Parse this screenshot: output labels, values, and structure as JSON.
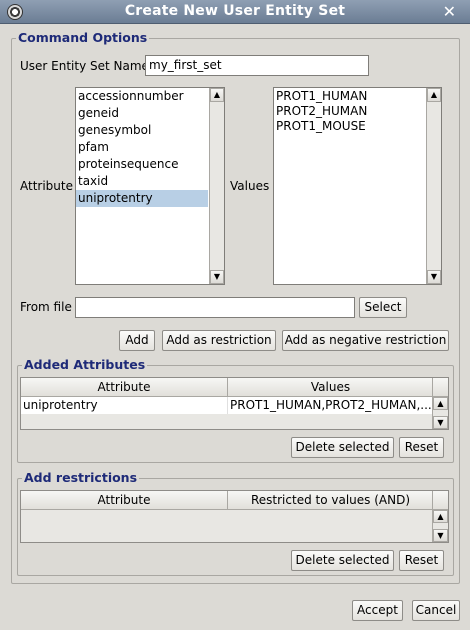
{
  "window": {
    "title": "Create New User Entity Set",
    "close_glyph": "✕",
    "icon": "app-icon"
  },
  "command_options": {
    "legend": "Command Options",
    "set_name_label": "User Entity Set Name",
    "set_name_value": "my_first_set",
    "attribute_label": "Attribute",
    "values_label": "Values",
    "attributes": [
      "accessionnumber",
      "geneid",
      "genesymbol",
      "pfam",
      "proteinsequence",
      "taxid",
      "uniprotentry"
    ],
    "selected_attribute_index": 6,
    "values": [
      "PROT1_HUMAN",
      "PROT2_HUMAN",
      "PROT1_MOUSE"
    ],
    "from_file_label": "From file",
    "from_file_value": "",
    "select_button": "Select",
    "add_button": "Add",
    "add_restriction_button": "Add as restriction",
    "add_negative_restriction_button": "Add as negative restriction"
  },
  "added_attributes": {
    "legend": "Added Attributes",
    "columns": [
      "Attribute",
      "Values"
    ],
    "rows": [
      {
        "attribute": "uniprotentry",
        "values": "PROT1_HUMAN,PROT2_HUMAN,..."
      }
    ],
    "delete_button": "Delete selected",
    "reset_button": "Reset"
  },
  "add_restrictions": {
    "legend": "Add restrictions",
    "columns": [
      "Attribute",
      "Restricted to values (AND)"
    ],
    "rows": [],
    "delete_button": "Delete selected",
    "reset_button": "Reset"
  },
  "footer": {
    "accept_button": "Accept",
    "cancel_button": "Cancel"
  },
  "icons": {
    "scroll_up": "▲",
    "scroll_down": "▼"
  }
}
